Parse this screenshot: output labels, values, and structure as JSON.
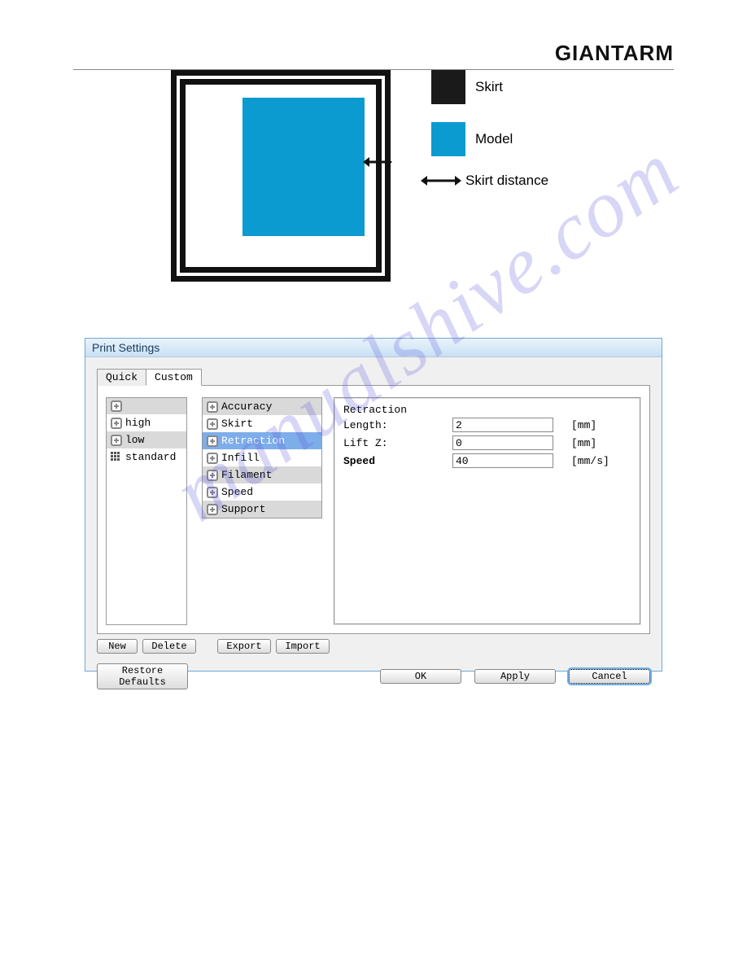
{
  "brand": "GIANTARM",
  "watermark": "manualshive.com",
  "diagram": {
    "legend_skirt": "Skirt",
    "legend_model": "Model",
    "skirt_distance": "Skirt distance"
  },
  "dialog": {
    "title": "Print Settings",
    "tabs": {
      "quick": "Quick",
      "custom": "Custom"
    },
    "profiles": [
      "",
      "high",
      "low",
      "standard"
    ],
    "categories": [
      "Accuracy",
      "Skirt",
      "Retraction",
      "Infill",
      "Filament",
      "Speed",
      "Support"
    ],
    "buttons": {
      "new": "New",
      "delete": "Delete",
      "export": "Export",
      "import": "Import",
      "restore": "Restore Defaults",
      "ok": "OK",
      "apply": "Apply",
      "cancel": "Cancel"
    },
    "group_title": "Retraction",
    "fields": {
      "length": {
        "label": "Length:",
        "value": "2",
        "unit": "[mm]"
      },
      "liftz": {
        "label": "Lift Z:",
        "value": "0",
        "unit": "[mm]"
      },
      "speed": {
        "label": "Speed",
        "value": "40",
        "unit": "[mm/s]"
      }
    }
  }
}
